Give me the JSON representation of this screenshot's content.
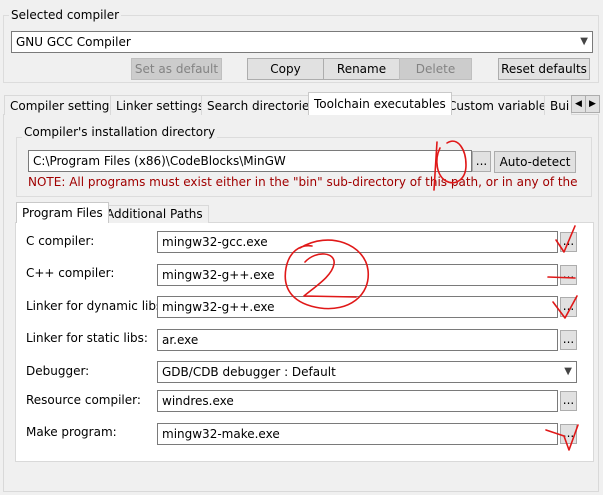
{
  "selected_compiler": {
    "group_label": "Selected compiler",
    "compiler_value": "GNU GCC Compiler",
    "buttons": {
      "set_default": "Set as default",
      "copy": "Copy",
      "rename": "Rename",
      "delete": "Delete",
      "reset_defaults": "Reset defaults"
    }
  },
  "tabs": [
    {
      "label": "Compiler settings"
    },
    {
      "label": "Linker settings"
    },
    {
      "label": "Search directories"
    },
    {
      "label": "Toolchain executables"
    },
    {
      "label": "Custom variables"
    },
    {
      "label": "Bui"
    }
  ],
  "install_dir": {
    "group_label": "Compiler's installation directory",
    "path": "C:\\Program Files (x86)\\CodeBlocks\\MinGW",
    "browse_label": "...",
    "autodetect_label": "Auto-detect",
    "note": "NOTE: All programs must exist either in the \"bin\" sub-directory of this path, or in any of the"
  },
  "subtabs": [
    {
      "label": "Program Files"
    },
    {
      "label": "Additional Paths"
    }
  ],
  "programs": [
    {
      "label": "C compiler:",
      "value": "mingw32-gcc.exe"
    },
    {
      "label": "C++ compiler:",
      "value": "mingw32-g++.exe"
    },
    {
      "label": "Linker for dynamic libs:",
      "value": "mingw32-g++.exe"
    },
    {
      "label": "Linker for static libs:",
      "value": "ar.exe"
    },
    {
      "label": "Debugger:",
      "value": "GDB/CDB debugger : Default"
    },
    {
      "label": "Resource compiler:",
      "value": "windres.exe"
    },
    {
      "label": "Make program:",
      "value": "mingw32-make.exe"
    }
  ],
  "browse_label": "...",
  "annotations": {
    "mark_1": "1",
    "mark_2": "2"
  },
  "colors": {
    "annotation_red": "#e01818",
    "note_red": "#a00000"
  }
}
